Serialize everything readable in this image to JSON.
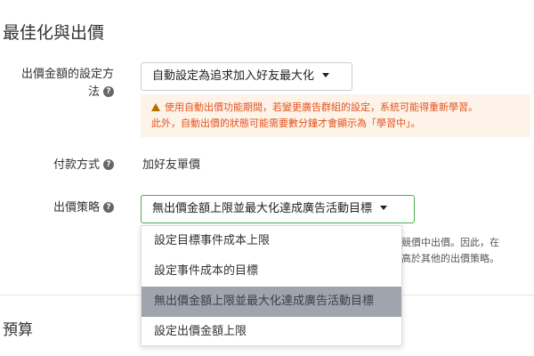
{
  "section": {
    "title": "最佳化與出價"
  },
  "bid_setting": {
    "label_line1": "出價金額的設定方",
    "label_line2": "法",
    "help": "?",
    "select_value": "自動設定為追求加入好友最大化",
    "warning_line1": "使用自動出價功能期間，若變更廣告群組的設定，系統可能得重新學習。",
    "warning_line2": "此外，自動出價的狀態可能需要數分鐘才會顯示為「學習中」。"
  },
  "payment": {
    "label": "付款方式",
    "help": "?",
    "value": "加好友單價"
  },
  "strategy": {
    "label": "出價策略",
    "help": "?",
    "select_value": "無出價金額上限並最大化達成廣告活動目標",
    "hint_line1": "吉競價中出價。因此，在",
    "hint_line2": "會高於其他的出價策略。",
    "options": [
      {
        "label": "設定目標事件成本上限"
      },
      {
        "label": "設定事件成本的目標"
      },
      {
        "label": "無出價金額上限並最大化達成廣告活動目標"
      },
      {
        "label": "設定出價金額上限"
      }
    ],
    "selected_index": 2
  },
  "budget": {
    "title": "預算"
  },
  "colors": {
    "accent_green": "#4caf50",
    "warning_text": "#e2531d",
    "warning_bg": "#fdf3e9",
    "selected_bg": "#9ea5ad"
  },
  "icons": {
    "help": "question-circle-icon",
    "warning": "warning-triangle-icon",
    "dropdown": "caret-down-icon"
  }
}
